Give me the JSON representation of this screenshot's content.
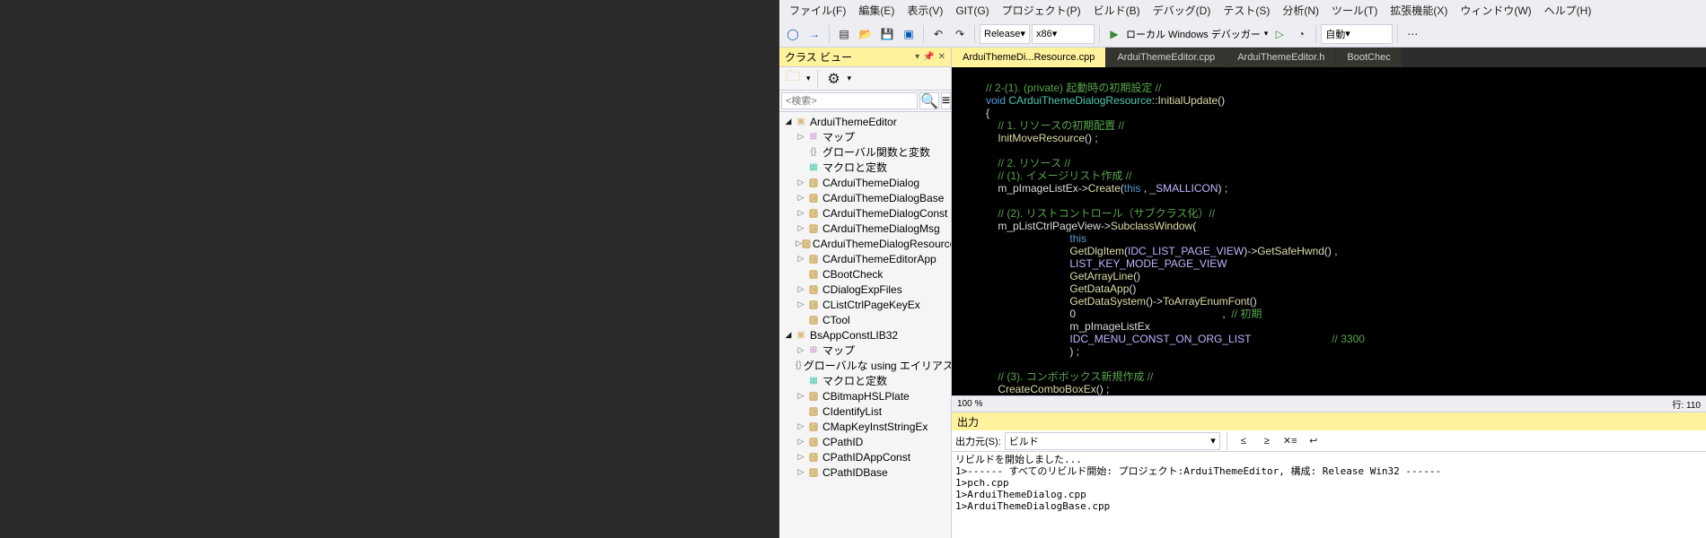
{
  "menubar": [
    "ファイル(F)",
    "編集(E)",
    "表示(V)",
    "GIT(G)",
    "プロジェクト(P)",
    "ビルド(B)",
    "デバッグ(D)",
    "テスト(S)",
    "分析(N)",
    "ツール(T)",
    "拡張機能(X)",
    "ウィンドウ(W)",
    "ヘルプ(H)"
  ],
  "toolbar": {
    "config": "Release",
    "platform": "x86",
    "debug_target": "ローカル Windows デバッガー",
    "auto": "自動"
  },
  "classview": {
    "title": "クラス ビュー",
    "search_placeholder": "<検索>",
    "tree": [
      {
        "d": 0,
        "a": "open",
        "i": "proj",
        "t": "ArduiThemeEditor"
      },
      {
        "d": 1,
        "a": "closed",
        "i": "map",
        "t": "マップ"
      },
      {
        "d": 1,
        "a": "none",
        "i": "global",
        "t": "グローバル関数と変数"
      },
      {
        "d": 1,
        "a": "none",
        "i": "macro",
        "t": "マクロと定数"
      },
      {
        "d": 1,
        "a": "closed",
        "i": "class",
        "t": "CArduiThemeDialog"
      },
      {
        "d": 1,
        "a": "closed",
        "i": "class",
        "t": "CArduiThemeDialogBase"
      },
      {
        "d": 1,
        "a": "closed",
        "i": "class",
        "t": "CArduiThemeDialogConst"
      },
      {
        "d": 1,
        "a": "closed",
        "i": "class",
        "t": "CArduiThemeDialogMsg"
      },
      {
        "d": 1,
        "a": "closed",
        "i": "class",
        "t": "CArduiThemeDialogResource"
      },
      {
        "d": 1,
        "a": "closed",
        "i": "class",
        "t": "CArduiThemeEditorApp"
      },
      {
        "d": 1,
        "a": "none",
        "i": "class",
        "t": "CBootCheck"
      },
      {
        "d": 1,
        "a": "closed",
        "i": "class",
        "t": "CDialogExpFiles"
      },
      {
        "d": 1,
        "a": "closed",
        "i": "class",
        "t": "CListCtrlPageKeyEx"
      },
      {
        "d": 1,
        "a": "none",
        "i": "class",
        "t": "CTool"
      },
      {
        "d": 0,
        "a": "open",
        "i": "proj",
        "t": "BsAppConstLIB32"
      },
      {
        "d": 1,
        "a": "closed",
        "i": "map",
        "t": "マップ"
      },
      {
        "d": 1,
        "a": "none",
        "i": "global",
        "t": "グローバルな using エイリアスと ty"
      },
      {
        "d": 1,
        "a": "none",
        "i": "macro",
        "t": "マクロと定数"
      },
      {
        "d": 1,
        "a": "closed",
        "i": "class",
        "t": "CBitmapHSLPlate"
      },
      {
        "d": 1,
        "a": "none",
        "i": "class",
        "t": "CIdentifyList"
      },
      {
        "d": 1,
        "a": "closed",
        "i": "class",
        "t": "CMapKeyInstStringEx"
      },
      {
        "d": 1,
        "a": "closed",
        "i": "class",
        "t": "CPathID"
      },
      {
        "d": 1,
        "a": "closed",
        "i": "class",
        "t": "CPathIDAppConst"
      },
      {
        "d": 1,
        "a": "closed",
        "i": "class",
        "t": "CPathIDBase"
      }
    ]
  },
  "tabs": [
    {
      "label": "ArduiThemeDi...Resource.cpp",
      "active": true
    },
    {
      "label": "ArduiThemeEditor.cpp",
      "active": false
    },
    {
      "label": "ArduiThemeEditor.h",
      "active": false
    },
    {
      "label": "BootChec",
      "active": false
    }
  ],
  "editor_status": {
    "zoom": "100 %",
    "col": "行: 110"
  },
  "output": {
    "title": "出力",
    "source_label": "出力元(S):",
    "source_value": "ビルド",
    "lines": [
      "リビルドを開始しました...",
      "1>------ すべてのリビルド開始: プロジェクト:ArduiThemeEditor, 構成: Release Win32 ------",
      "1>pch.cpp",
      "1>ArduiThemeDialog.cpp",
      "1>ArduiThemeDialogBase.cpp"
    ]
  },
  "code": {
    "l1a": "// 2-(1). (private) 起動時の初期設定 //",
    "l2_kw": "void",
    "l2_type": " CArduiThemeDialogResource",
    "l2_op": "::",
    "l2_fn": "InitialUpdate",
    "l2_p": "()",
    "l3": "{",
    "l4": "    // 1. リソースの初期配置 //",
    "l5_fn": "    InitMoveResource",
    "l5_p": "() ;",
    "l7": "    // 2. リソース //",
    "l8": "    // (1). イメージリスト作成 //",
    "l9_a": "    m_pImageListEx->",
    "l9_fn": "Create",
    "l9_b": "(",
    "l9_this": "this",
    "l9_c": " , ",
    "l9_m": "_SMALLICON",
    "l9_d": ") ;",
    "l11": "    // (2). リストコントロール（サブクラス化）//",
    "l12_a": "    m_pListCtrlPageView->",
    "l12_fn": "SubclassWindow",
    "l12_b": "(",
    "l13_a": "                            ",
    "l13_this": "this",
    "l14_a": "                            ",
    "l14_fn": "GetDlgItem",
    "l14_b": "(",
    "l14_m": "IDC_LIST_PAGE_VIEW",
    "l14_c": ")->",
    "l14_fn2": "GetSafeHwnd",
    "l14_d": "() ,",
    "l15_a": "                            ",
    "l15_m": "LIST_KEY_MODE_PAGE_VIEW",
    "l16_a": "                            ",
    "l16_fn": "GetArrayLine",
    "l16_b": "()",
    "l17_a": "                            ",
    "l17_fn": "GetDataApp",
    "l17_b": "()",
    "l18_a": "                            ",
    "l18_fn": "GetDataSystem",
    "l18_b": "()->",
    "l18_fn2": "ToArrayEnumFont",
    "l18_c": "()",
    "l19_a": "                            0",
    "l19_c": "                                                 ,  ",
    "l19_cm": "// 初期",
    "l20_a": "                            m_pImageListEx",
    "l21_a": "                            ",
    "l21_m": "IDC_MENU_CONST_ON_ORG_LIST",
    "l21_c": "                           ",
    "l21_cm": "// 3300",
    "l22_a": "                            ) ;",
    "l24": "    // (3). コンボボックス新規作成 //",
    "l25_fn": "    CreateComboBoxEx",
    "l25_p": "() ;"
  }
}
